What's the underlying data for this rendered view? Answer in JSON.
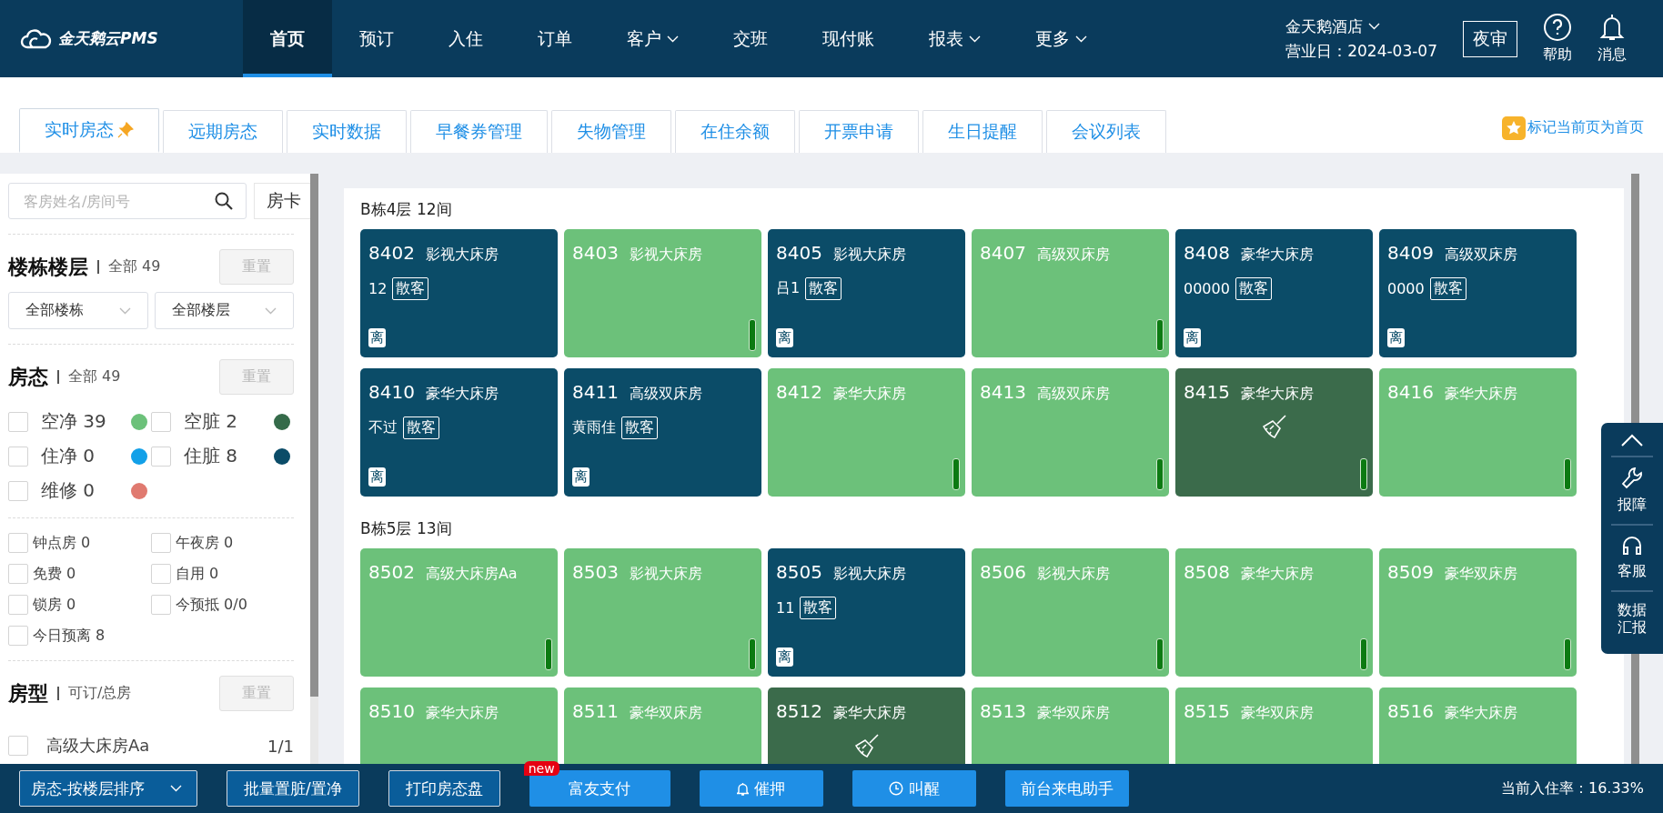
{
  "nav": {
    "logo": "金天鹅云PMS",
    "items": [
      {
        "label": "首页",
        "selected": true,
        "dropdown": false
      },
      {
        "label": "预订",
        "selected": false,
        "dropdown": false
      },
      {
        "label": "入住",
        "selected": false,
        "dropdown": false
      },
      {
        "label": "订单",
        "selected": false,
        "dropdown": false
      },
      {
        "label": "客户",
        "selected": false,
        "dropdown": true
      },
      {
        "label": "交班",
        "selected": false,
        "dropdown": false
      },
      {
        "label": "现付账",
        "selected": false,
        "dropdown": false
      },
      {
        "label": "报表",
        "selected": false,
        "dropdown": true
      },
      {
        "label": "更多",
        "selected": false,
        "dropdown": true
      }
    ],
    "hotel": "金天鹅酒店",
    "business_date": "营业日：2024-03-07",
    "night_audit": "夜审",
    "help": "帮助",
    "messages": "消息"
  },
  "tabs": [
    {
      "label": "实时房态",
      "selected": true,
      "pinned": true
    },
    {
      "label": "远期房态",
      "selected": false,
      "pinned": false
    },
    {
      "label": "实时数据",
      "selected": false,
      "pinned": false
    },
    {
      "label": "早餐券管理",
      "selected": false,
      "pinned": false
    },
    {
      "label": "失物管理",
      "selected": false,
      "pinned": false
    },
    {
      "label": "在住余额",
      "selected": false,
      "pinned": false
    },
    {
      "label": "开票申请",
      "selected": false,
      "pinned": false
    },
    {
      "label": "生日提醒",
      "selected": false,
      "pinned": false
    },
    {
      "label": "会议列表",
      "selected": false,
      "pinned": false
    }
  ],
  "set_home": "标记当前页为首页",
  "sidebar": {
    "search": {
      "placeholder": "客房姓名/房间号"
    },
    "room_card_button": "房卡",
    "floor_section": {
      "title": "楼栋楼层",
      "summary": "全部 49",
      "reset": "重置",
      "building": "全部楼栋",
      "floor": "全部楼层"
    },
    "status_section": {
      "title": "房态",
      "summary": "全部 49",
      "reset": "重置",
      "statuses": [
        {
          "label": "空净 39",
          "checked": false,
          "color": "#6cc17a"
        },
        {
          "label": "空脏 2",
          "checked": false,
          "color": "#356b4a"
        },
        {
          "label": "住净 0",
          "checked": false,
          "color": "#12a0e8"
        },
        {
          "label": "住脏 8",
          "checked": false,
          "color": "#0b4c68"
        },
        {
          "label": "维修 0",
          "checked": false,
          "color": "#e07a70"
        }
      ],
      "filters": [
        {
          "label": "钟点房 0",
          "checked": false
        },
        {
          "label": "午夜房 0",
          "checked": false
        },
        {
          "label": "免费 0",
          "checked": false
        },
        {
          "label": "自用 0",
          "checked": false
        },
        {
          "label": "锁房 0",
          "checked": false
        },
        {
          "label": "今预抵 0/0",
          "checked": false
        },
        {
          "label": "今日预离 8",
          "checked": false
        }
      ]
    },
    "room_type_section": {
      "title": "房型",
      "summary": "可订/总房",
      "reset": "重置",
      "types": [
        {
          "label": "高级大床房Aa",
          "count": "1/1",
          "checked": false
        }
      ]
    }
  },
  "floors": [
    {
      "title": "B栋4层 12间",
      "rooms": [
        {
          "number": "8402",
          "type": "影视大床房",
          "kind": "occupied",
          "color": "#0b4c68",
          "guest": "12",
          "source": "散客",
          "departure": "离"
        },
        {
          "number": "8403",
          "type": "影视大床房",
          "kind": "vacant",
          "color": "#6cc17a"
        },
        {
          "number": "8405",
          "type": "影视大床房",
          "kind": "occupied",
          "color": "#0b4c68",
          "guest": "吕1",
          "source": "散客",
          "departure": "离"
        },
        {
          "number": "8407",
          "type": "高级双床房",
          "kind": "vacant",
          "color": "#6cc17a"
        },
        {
          "number": "8408",
          "type": "豪华大床房",
          "kind": "occupied",
          "color": "#0b4c68",
          "guest": "00000",
          "source": "散客",
          "departure": "离"
        },
        {
          "number": "8409",
          "type": "高级双床房",
          "kind": "occupied",
          "color": "#0b4c68",
          "guest": "0000",
          "source": "散客",
          "departure": "离"
        },
        {
          "number": "8410",
          "type": "豪华大床房",
          "kind": "occupied",
          "color": "#0b4c68",
          "guest": "不过",
          "source": "散客",
          "departure": "离"
        },
        {
          "number": "8411",
          "type": "高级双床房",
          "kind": "occupied",
          "color": "#0b4c68",
          "guest": "黄雨佳",
          "source": "散客",
          "departure": "离"
        },
        {
          "number": "8412",
          "type": "豪华大床房",
          "kind": "vacant",
          "color": "#6cc17a"
        },
        {
          "number": "8413",
          "type": "高级双床房",
          "kind": "vacant",
          "color": "#6cc17a"
        },
        {
          "number": "8415",
          "type": "豪华大床房",
          "kind": "dirty",
          "color": "#3b6b4b"
        },
        {
          "number": "8416",
          "type": "豪华大床房",
          "kind": "vacant",
          "color": "#6cc17a"
        }
      ]
    },
    {
      "title": "B栋5层 13间",
      "rooms": [
        {
          "number": "8502",
          "type": "高级大床房Aa",
          "kind": "vacant",
          "color": "#6cc17a"
        },
        {
          "number": "8503",
          "type": "影视大床房",
          "kind": "vacant",
          "color": "#6cc17a"
        },
        {
          "number": "8505",
          "type": "影视大床房",
          "kind": "occupied",
          "color": "#0b4c68",
          "guest": "11",
          "source": "散客",
          "departure": "离"
        },
        {
          "number": "8506",
          "type": "影视大床房",
          "kind": "vacant",
          "color": "#6cc17a"
        },
        {
          "number": "8508",
          "type": "豪华大床房",
          "kind": "vacant",
          "color": "#6cc17a"
        },
        {
          "number": "8509",
          "type": "豪华双床房",
          "kind": "vacant",
          "color": "#6cc17a"
        },
        {
          "number": "8510",
          "type": "豪华大床房",
          "kind": "vacant",
          "color": "#6cc17a"
        },
        {
          "number": "8511",
          "type": "豪华双床房",
          "kind": "vacant",
          "color": "#6cc17a"
        },
        {
          "number": "8512",
          "type": "豪华大床房",
          "kind": "dirty",
          "color": "#3b6b4b"
        },
        {
          "number": "8513",
          "type": "豪华双床房",
          "kind": "vacant",
          "color": "#6cc17a"
        },
        {
          "number": "8515",
          "type": "豪华双床房",
          "kind": "vacant",
          "color": "#6cc17a"
        },
        {
          "number": "8516",
          "type": "豪华大床房",
          "kind": "vacant",
          "color": "#6cc17a"
        }
      ]
    }
  ],
  "side_panel": {
    "report": "报障",
    "service": "客服",
    "data_report": "数据汇报"
  },
  "bottom_bar": {
    "sort": "房态-按楼层排序",
    "buttons": [
      {
        "label": "批量置脏/置净",
        "kind": "outline"
      },
      {
        "label": "打印房态盘",
        "kind": "outline"
      },
      {
        "label": "富友支付",
        "kind": "primary",
        "badge": "new"
      },
      {
        "label": "催押",
        "kind": "bell"
      },
      {
        "label": "叫醒",
        "kind": "clock"
      },
      {
        "label": "前台来电助手",
        "kind": "primary"
      }
    ],
    "occupancy": "当前入住率：16.33%"
  }
}
